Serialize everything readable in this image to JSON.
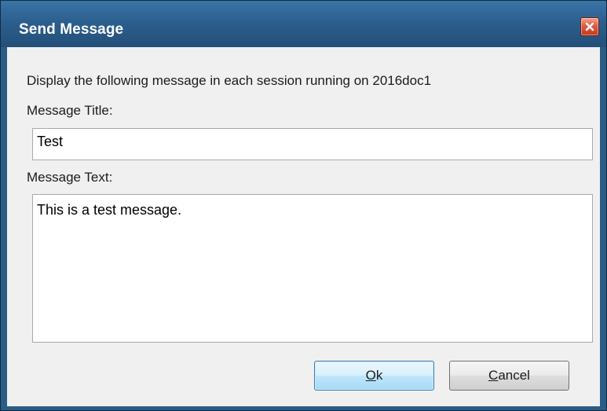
{
  "window": {
    "title": "Send Message"
  },
  "icons": {
    "close": "close-icon"
  },
  "colors": {
    "titlebar": "#2c5f8e",
    "close_button": "#de5b40",
    "client_background": "#f0f0f0",
    "ok_button_border": "#3c7fb1"
  },
  "dialog": {
    "description": "Display the following message in each session running on 2016doc1",
    "title_label": "Message Title:",
    "title_value": "Test",
    "text_label": "Message Text:",
    "text_value": "This is a test message."
  },
  "buttons": {
    "ok_mnemonic": "O",
    "ok_rest": "k",
    "cancel_mnemonic": "C",
    "cancel_rest": "ancel"
  }
}
